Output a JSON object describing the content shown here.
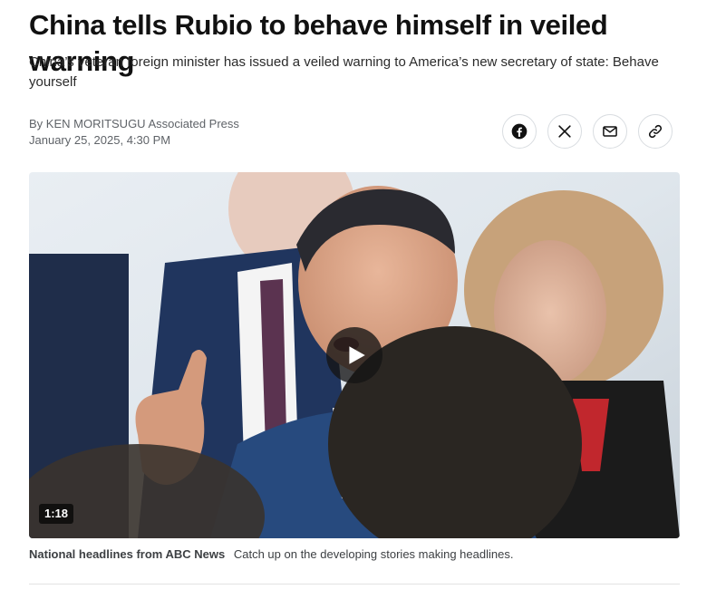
{
  "article": {
    "headline": "China tells Rubio to behave himself in veiled warning",
    "dek": "China’s veteran foreign minister has issued a veiled warning to America’s new secretary of state: Behave yourself",
    "byline": "By KEN MORITSUGU Associated Press",
    "timestamp": "January 25, 2025, 4:30 PM"
  },
  "share": {
    "buttons": [
      {
        "icon": "facebook-icon"
      },
      {
        "icon": "x-icon"
      },
      {
        "icon": "mail-icon"
      },
      {
        "icon": "link-icon"
      }
    ]
  },
  "video": {
    "duration": "1:18",
    "play_icon": "play-icon"
  },
  "caption": {
    "source": "National headlines from ABC News",
    "text": "Catch up on the developing stories making headlines."
  },
  "colors": {
    "text": "#111111",
    "muted": "#5f6368",
    "border": "#d9dde1"
  }
}
